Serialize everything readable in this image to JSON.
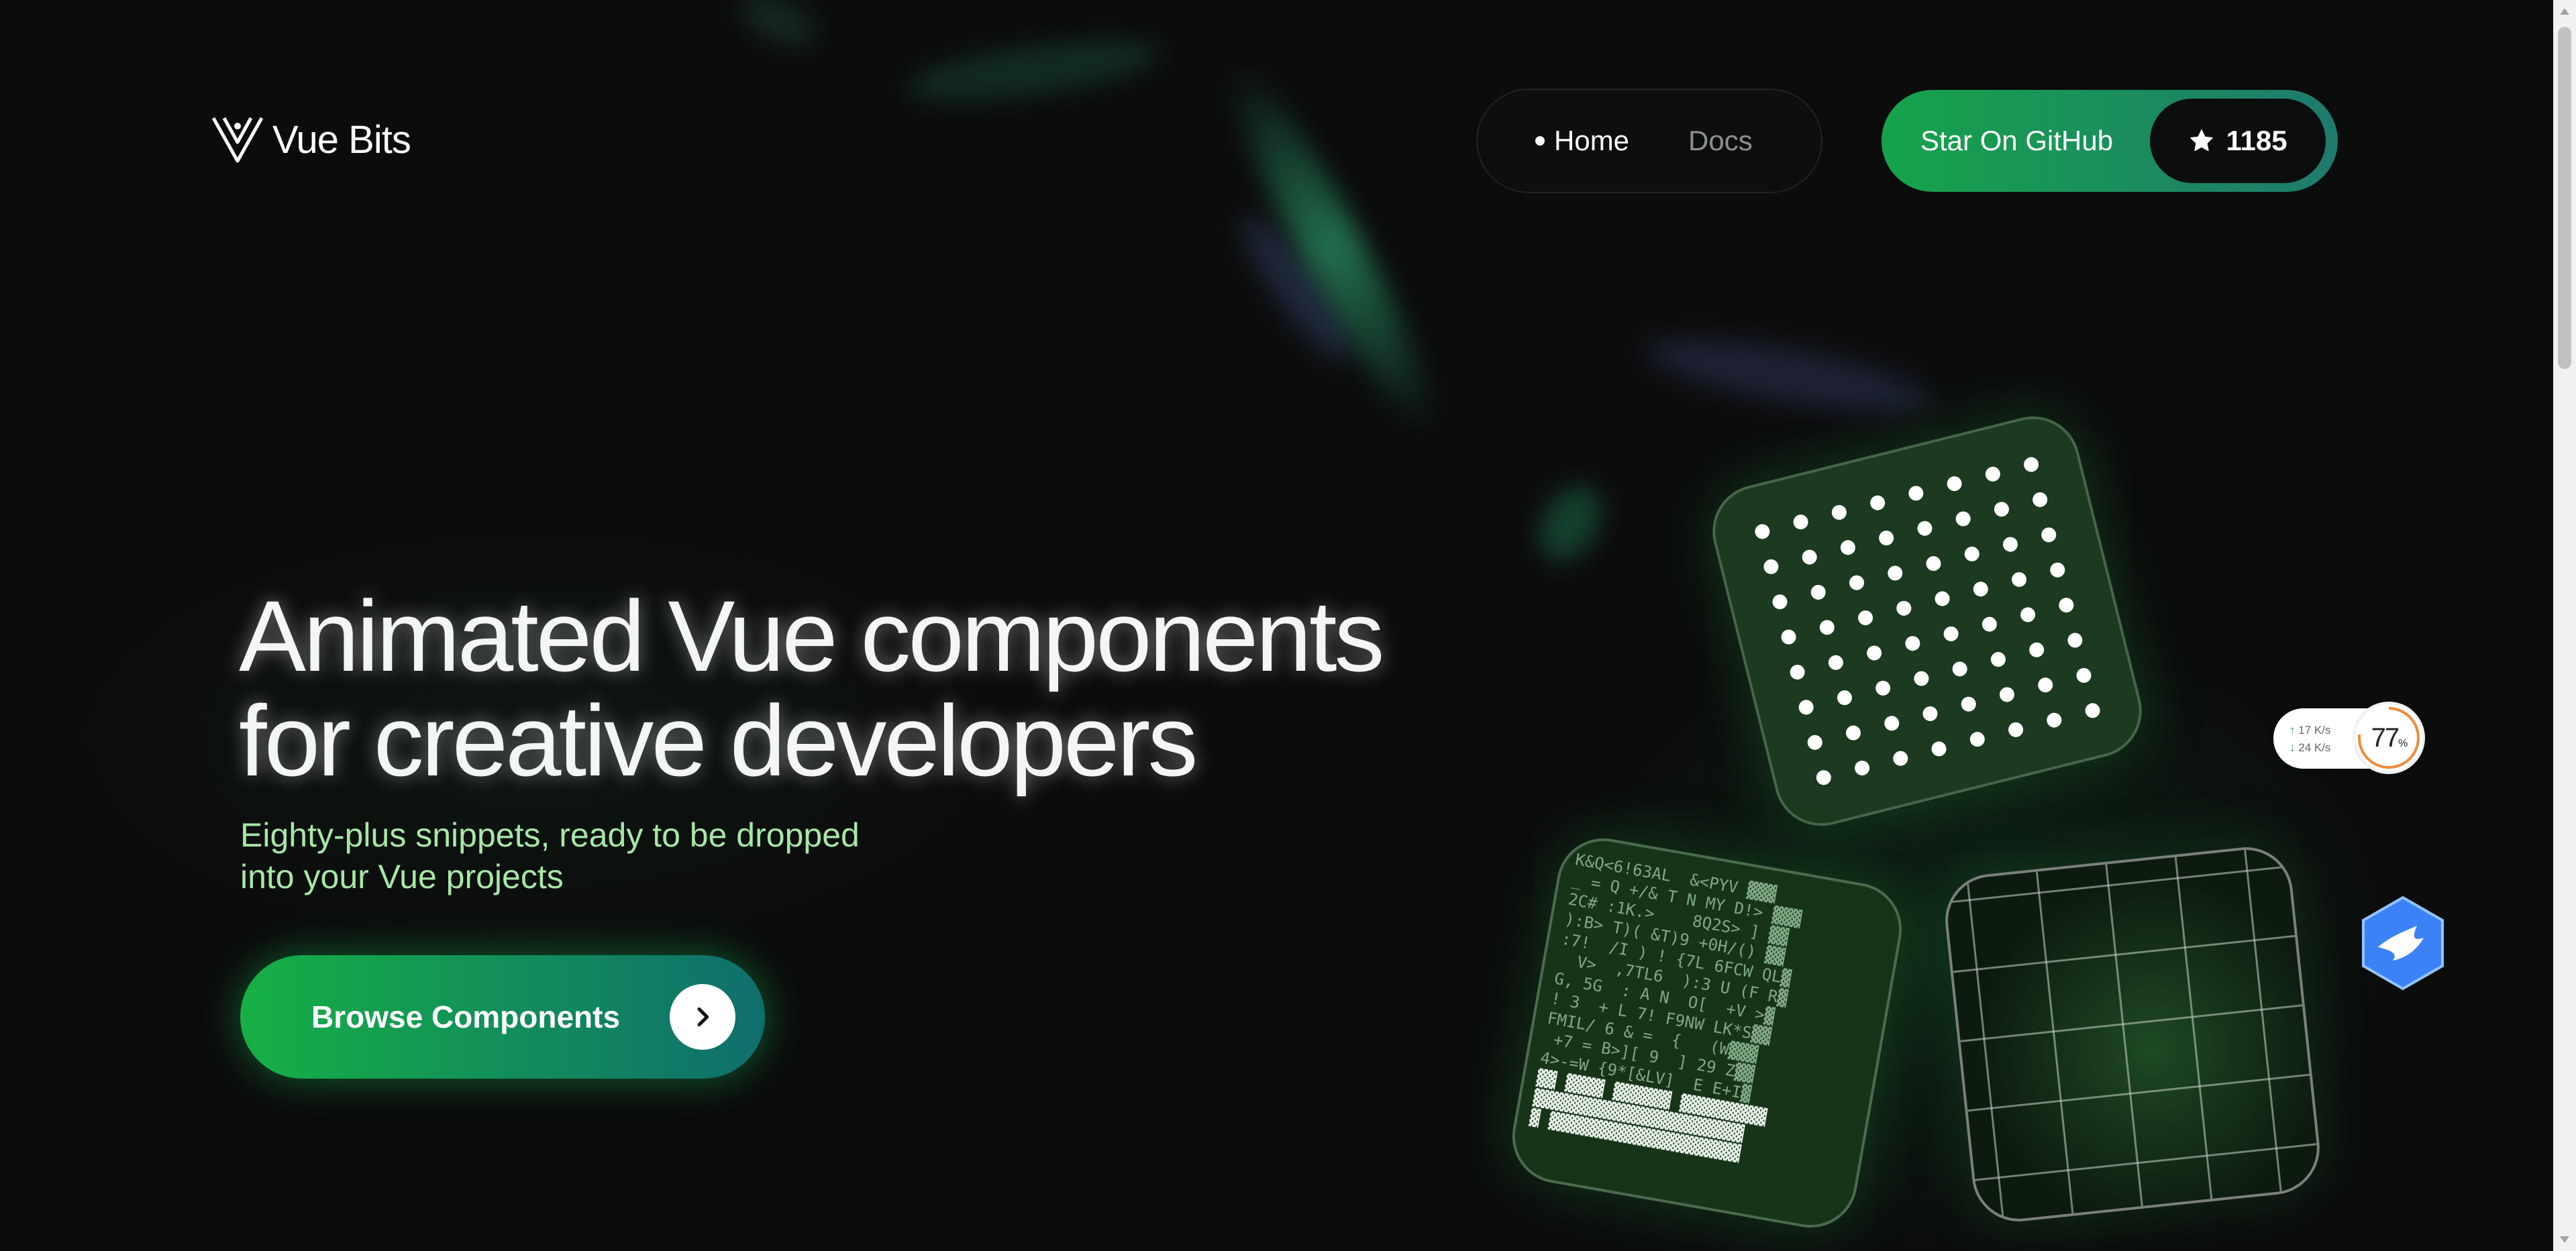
{
  "header": {
    "logo_text": "Vue Bits",
    "nav": {
      "home_label": "Home",
      "docs_label": "Docs"
    },
    "github": {
      "label": "Star On GitHub",
      "stars": "1185"
    }
  },
  "hero": {
    "title_line1": "Animated Vue components",
    "title_line2": "for creative developers",
    "subtitle_line1": "Eighty-plus snippets, ready to be dropped",
    "subtitle_line2": "into your Vue projects",
    "cta_label": "Browse Components"
  },
  "widgets": {
    "net_up": "17  K/s",
    "net_down": "24  K/s",
    "usage_value": "77",
    "usage_unit": "%"
  },
  "colors": {
    "accent_green": "#16a34a",
    "accent_teal": "#1f7a6e",
    "background": "#0b0c0c",
    "subtitle": "#a8e6a8"
  },
  "icons": [
    "vue-bits-logo-icon",
    "nav-dot-icon",
    "star-icon",
    "chevron-right-icon",
    "bird-app-icon",
    "scroll-up-icon",
    "scroll-down-icon"
  ]
}
